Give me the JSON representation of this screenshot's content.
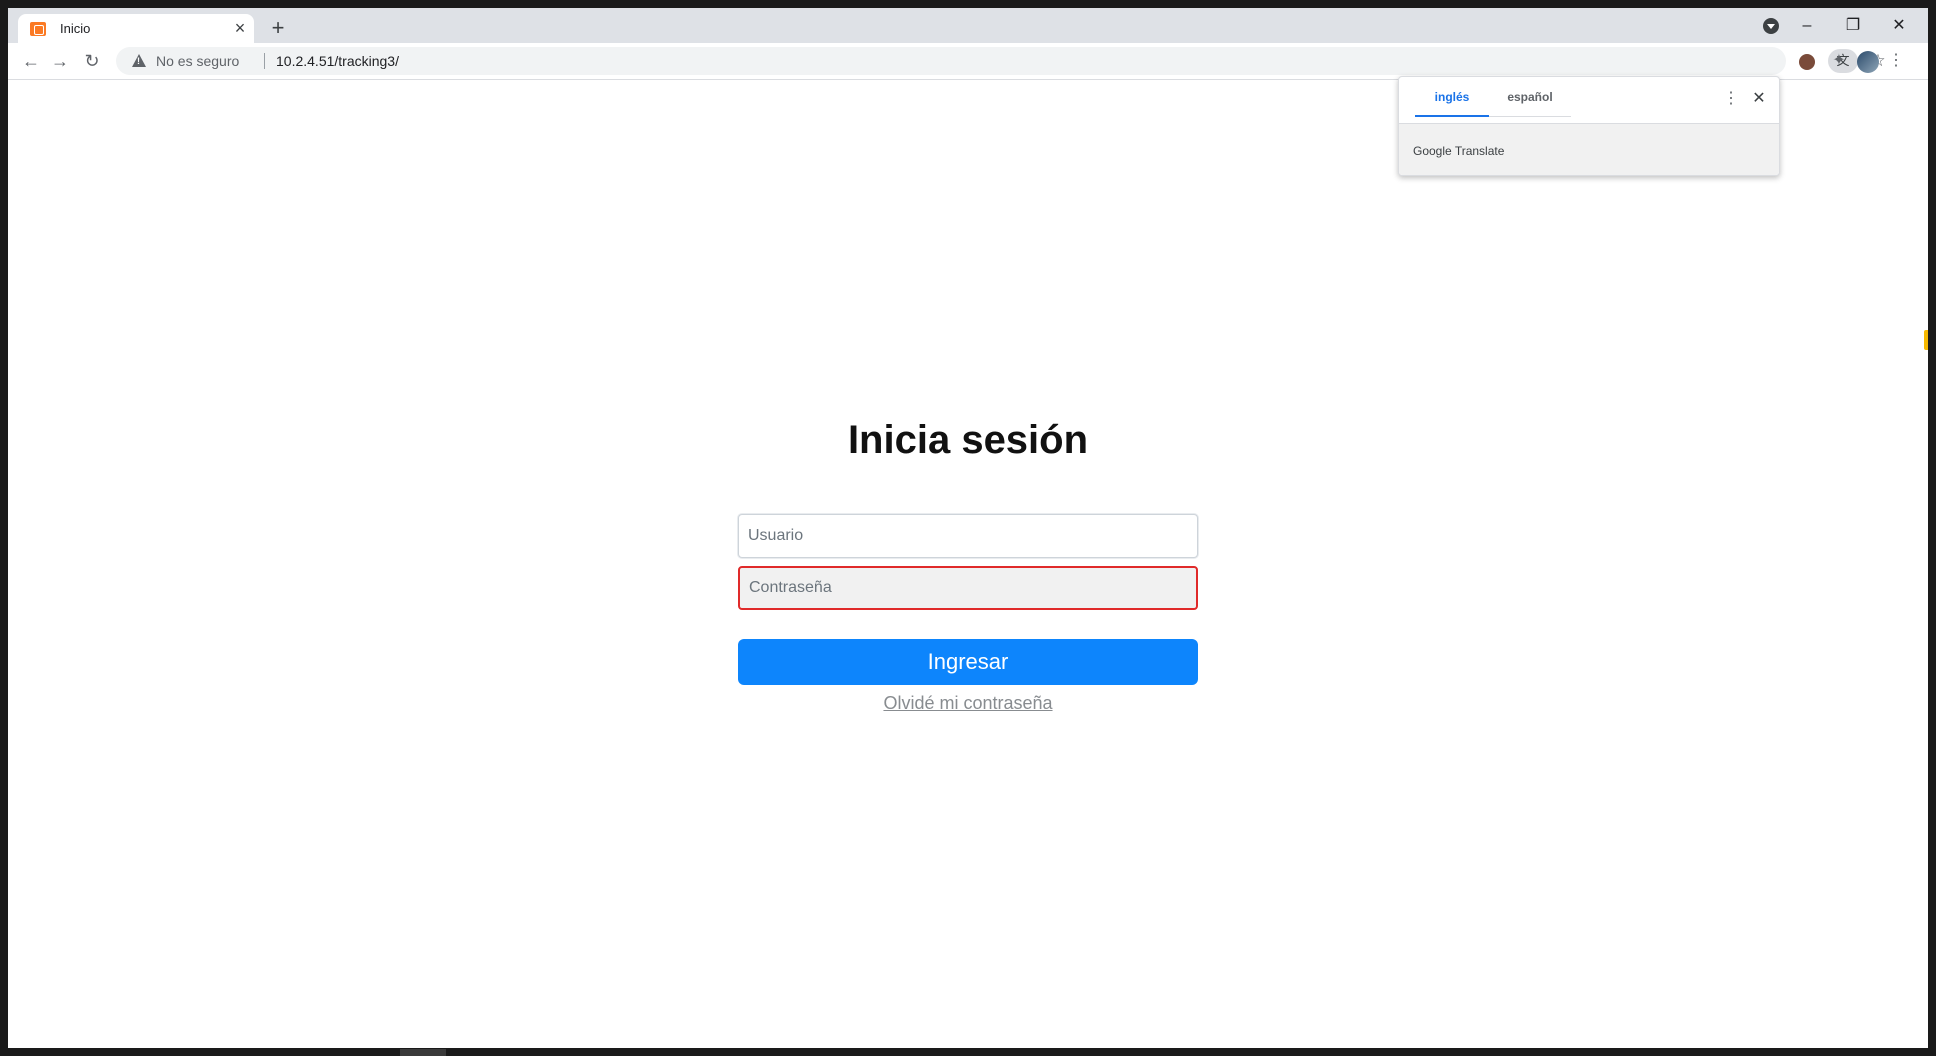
{
  "browser": {
    "tab_title": "Inicio",
    "security_label": "No es seguro",
    "url": "10.2.4.51/tracking3/"
  },
  "translate_popup": {
    "tab_source": "inglés",
    "tab_target": "español",
    "brand": "Google Translate"
  },
  "login": {
    "heading": "Inicia sesión",
    "username_placeholder": "Usuario",
    "password_placeholder": "Contraseña",
    "submit_label": "Ingresar",
    "forgot_label": "Olvidé mi contraseña"
  },
  "colors": {
    "primary": "#0d85fc",
    "error_border": "#e02a2a",
    "favicon": "#fb7a24"
  }
}
